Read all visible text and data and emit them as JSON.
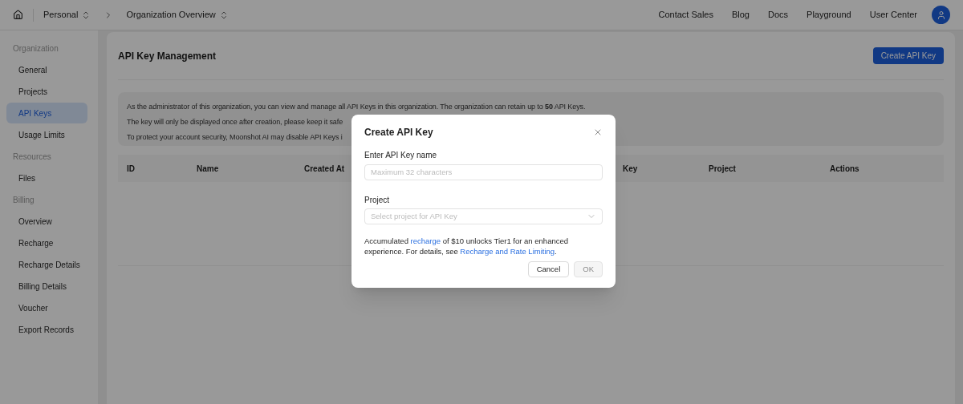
{
  "topbar": {
    "breadcrumbs": [
      {
        "label": "Personal"
      },
      {
        "label": "Organization Overview"
      }
    ],
    "nav": [
      "Contact Sales",
      "Blog",
      "Docs",
      "Playground",
      "User Center"
    ]
  },
  "sidebar": {
    "groups": [
      {
        "title": "Organization",
        "items": [
          {
            "label": "General",
            "selected": false
          },
          {
            "label": "Projects",
            "selected": false
          },
          {
            "label": "API Keys",
            "selected": true
          },
          {
            "label": "Usage Limits",
            "selected": false
          }
        ]
      },
      {
        "title": "Resources",
        "items": [
          {
            "label": "Files",
            "selected": false
          }
        ]
      },
      {
        "title": "Billing",
        "items": [
          {
            "label": "Overview",
            "selected": false
          },
          {
            "label": "Recharge",
            "selected": false
          },
          {
            "label": "Recharge Details",
            "selected": false
          },
          {
            "label": "Billing Details",
            "selected": false
          },
          {
            "label": "Voucher",
            "selected": false
          },
          {
            "label": "Export Records",
            "selected": false
          }
        ]
      }
    ]
  },
  "main": {
    "title": "API Key Management",
    "create_button": "Create API Key",
    "info": [
      "As the administrator of this organization, you can view and manage all API Keys in this organization. The organization can retain up to **50** API Keys.",
      "The key will only be displayed once after creation, please keep it safe",
      "To protect your account security, Moonshot AI may disable API Keys i"
    ],
    "table": {
      "columns": [
        {
          "label": "ID"
        },
        {
          "label": "Name"
        },
        {
          "label": "Created At"
        },
        {
          "label": "Key"
        },
        {
          "label": "Project"
        },
        {
          "label": "Actions"
        }
      ]
    }
  },
  "dialog": {
    "title": "Create API Key",
    "name_field": {
      "label": "Enter API Key name",
      "placeholder": "Maximum 32 characters"
    },
    "project_field": {
      "label": "Project",
      "placeholder": "Select project for API Key"
    },
    "notice": {
      "text_1": "Accumulated ",
      "link_1": "recharge",
      "text_2": " of $10 unlocks Tier1 for an enhanced experience. For details, see ",
      "link_2": "Recharge and Rate Limiting",
      "text_3": "."
    },
    "buttons": [
      {
        "label": "Cancel",
        "disabled": false
      },
      {
        "label": "OK",
        "disabled": true
      }
    ]
  }
}
